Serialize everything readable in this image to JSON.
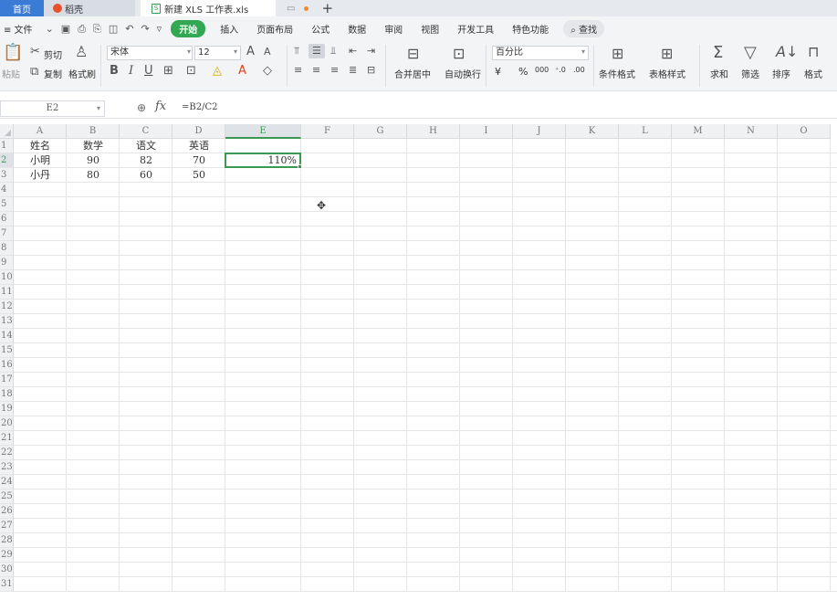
{
  "tabs": {
    "home": "首页",
    "docer": "稻壳",
    "file": "新建 XLS 工作表.xls",
    "file_icon": "S",
    "add": "+"
  },
  "menu": {
    "file": "≡ 文件",
    "items": [
      "开始",
      "插入",
      "页面布局",
      "公式",
      "数据",
      "审阅",
      "视图",
      "开发工具",
      "特色功能"
    ],
    "search": "查找"
  },
  "ribbon": {
    "paste": "粘贴",
    "cut": "剪切",
    "copy": "复制",
    "format_painter": "格式刷",
    "font_name": "宋体",
    "font_size": "12",
    "merge": "合并居中",
    "wrap": "自动换行",
    "number_format": "百分比",
    "conditional": "条件格式",
    "table_style": "表格样式",
    "sum": "求和",
    "filter": "筛选",
    "sort": "排序",
    "format": "格式"
  },
  "formula_bar": {
    "cell_ref": "E2",
    "formula": "=B2/C2"
  },
  "columns": [
    "A",
    "B",
    "C",
    "D",
    "E",
    "F",
    "G",
    "H",
    "I",
    "J",
    "K",
    "L",
    "M",
    "N",
    "O"
  ],
  "rows": [
    "1",
    "2",
    "3",
    "4",
    "5",
    "6",
    "7",
    "8",
    "9",
    "10",
    "11",
    "12",
    "13",
    "14",
    "15",
    "16",
    "17",
    "18",
    "19",
    "20",
    "21",
    "22",
    "23",
    "24",
    "25",
    "26",
    "27",
    "28",
    "29",
    "30",
    "31"
  ],
  "cells": {
    "A1": "姓名",
    "B1": "数学",
    "C1": "语文",
    "D1": "英语",
    "A2": "小明",
    "B2": "90",
    "C2": "82",
    "D2": "70",
    "E2": "110%",
    "A3": "小丹",
    "B3": "80",
    "C3": "60",
    "D3": "50"
  },
  "colors": {
    "accent": "#32a852",
    "tab_blue": "#3a7bd5"
  }
}
